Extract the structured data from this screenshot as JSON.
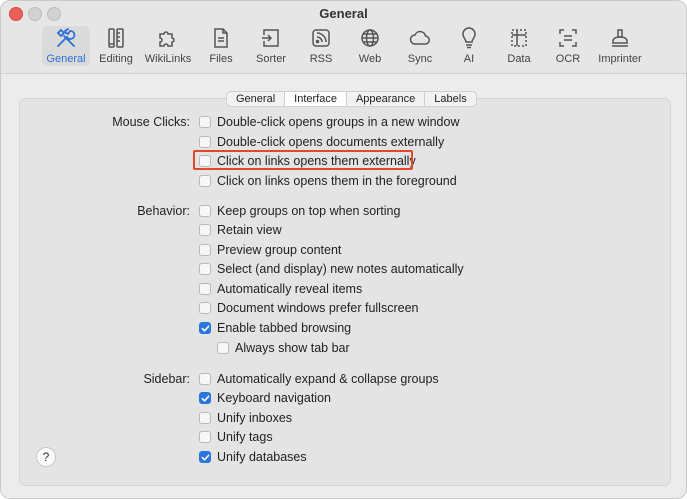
{
  "window": {
    "title": "General"
  },
  "toolbar": {
    "items": [
      {
        "label": "General",
        "icon": "tools-icon",
        "active": true
      },
      {
        "label": "Editing",
        "icon": "pencil-ruler-icon"
      },
      {
        "label": "WikiLinks",
        "icon": "puzzle-icon"
      },
      {
        "label": "Files",
        "icon": "files-icon"
      },
      {
        "label": "Sorter",
        "icon": "sorter-icon"
      },
      {
        "label": "RSS",
        "icon": "rss-icon"
      },
      {
        "label": "Web",
        "icon": "globe-icon"
      },
      {
        "label": "Sync",
        "icon": "cloud-icon"
      },
      {
        "label": "AI",
        "icon": "lightbulb-icon"
      },
      {
        "label": "Data",
        "icon": "data-icon"
      },
      {
        "label": "OCR",
        "icon": "ocr-icon"
      },
      {
        "label": "Imprinter",
        "icon": "stamp-icon"
      }
    ],
    "accent": "#2b6fd6"
  },
  "tabs": {
    "items": [
      "General",
      "Interface",
      "Appearance",
      "Labels"
    ],
    "selected": "Interface"
  },
  "sections": {
    "mouse_clicks": {
      "label": "Mouse Clicks:",
      "options": [
        {
          "label": "Double-click opens groups in a new window",
          "checked": false
        },
        {
          "label": "Double-click opens documents externally",
          "checked": false
        },
        {
          "label": "Click on links opens them externally",
          "checked": false
        },
        {
          "label": "Click on links opens them in the foreground",
          "checked": false
        }
      ]
    },
    "behavior": {
      "label": "Behavior:",
      "options": [
        {
          "label": "Keep groups on top when sorting",
          "checked": false
        },
        {
          "label": "Retain view",
          "checked": false
        },
        {
          "label": "Preview group content",
          "checked": false
        },
        {
          "label": "Select (and display) new notes automatically",
          "checked": false
        },
        {
          "label": "Automatically reveal items",
          "checked": false
        },
        {
          "label": "Document windows prefer fullscreen",
          "checked": false
        },
        {
          "label": "Enable tabbed browsing",
          "checked": true
        },
        {
          "label": "Always show tab bar",
          "checked": false
        }
      ]
    },
    "sidebar": {
      "label": "Sidebar:",
      "options": [
        {
          "label": "Automatically expand & collapse groups",
          "checked": false
        },
        {
          "label": "Keyboard navigation",
          "checked": true
        },
        {
          "label": "Unify inboxes",
          "checked": false
        },
        {
          "label": "Unify tags",
          "checked": false
        },
        {
          "label": "Unify databases",
          "checked": true
        }
      ]
    }
  },
  "help": {
    "label": "?"
  },
  "colors": {
    "checkbox_on": "#2c75de",
    "highlight": "#e0492a"
  }
}
